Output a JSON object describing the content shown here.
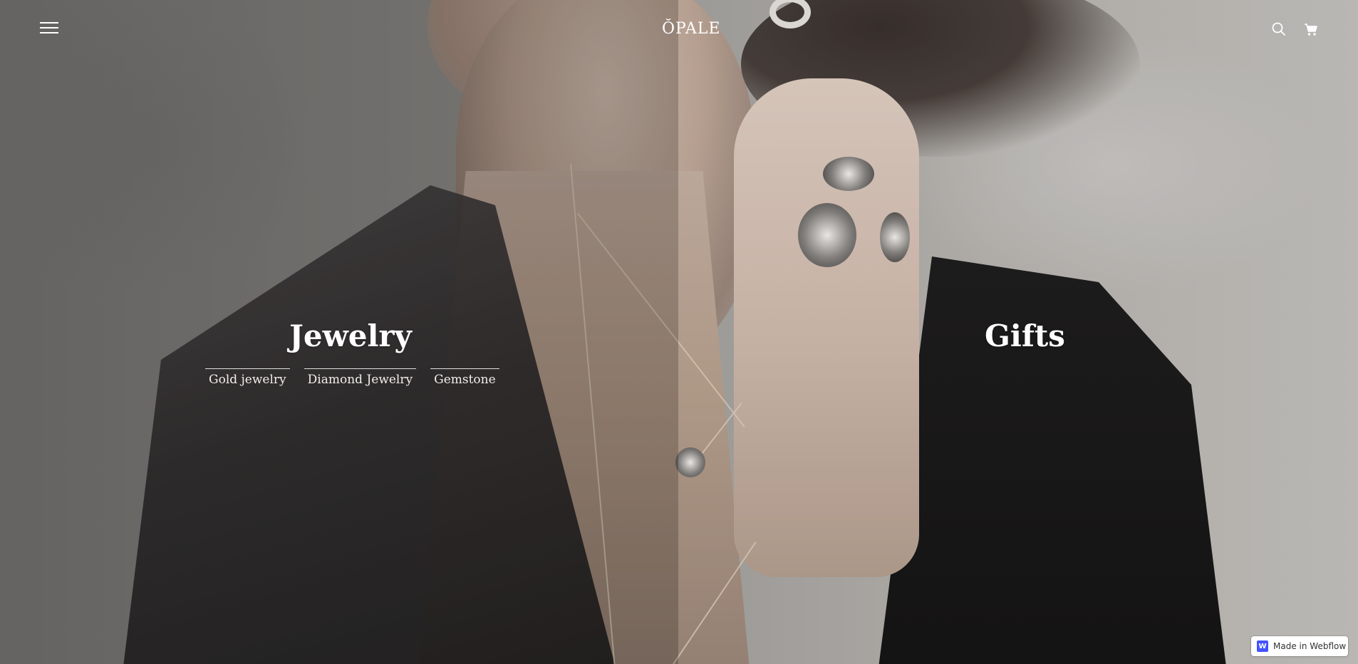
{
  "header": {
    "logo": "ŎPALE",
    "menu_icon": "hamburger-icon",
    "search_icon": "search-icon",
    "cart_icon": "cart-icon"
  },
  "categories": {
    "left": {
      "title": "Jewelry",
      "links": [
        "Gold jewelry",
        "Diamond Jewelry",
        "Gemstone"
      ]
    },
    "right": {
      "title": "Gifts"
    }
  },
  "badge": {
    "logo_letter": "W",
    "label": "Made in Webflow",
    "accent": "#4353ff"
  }
}
